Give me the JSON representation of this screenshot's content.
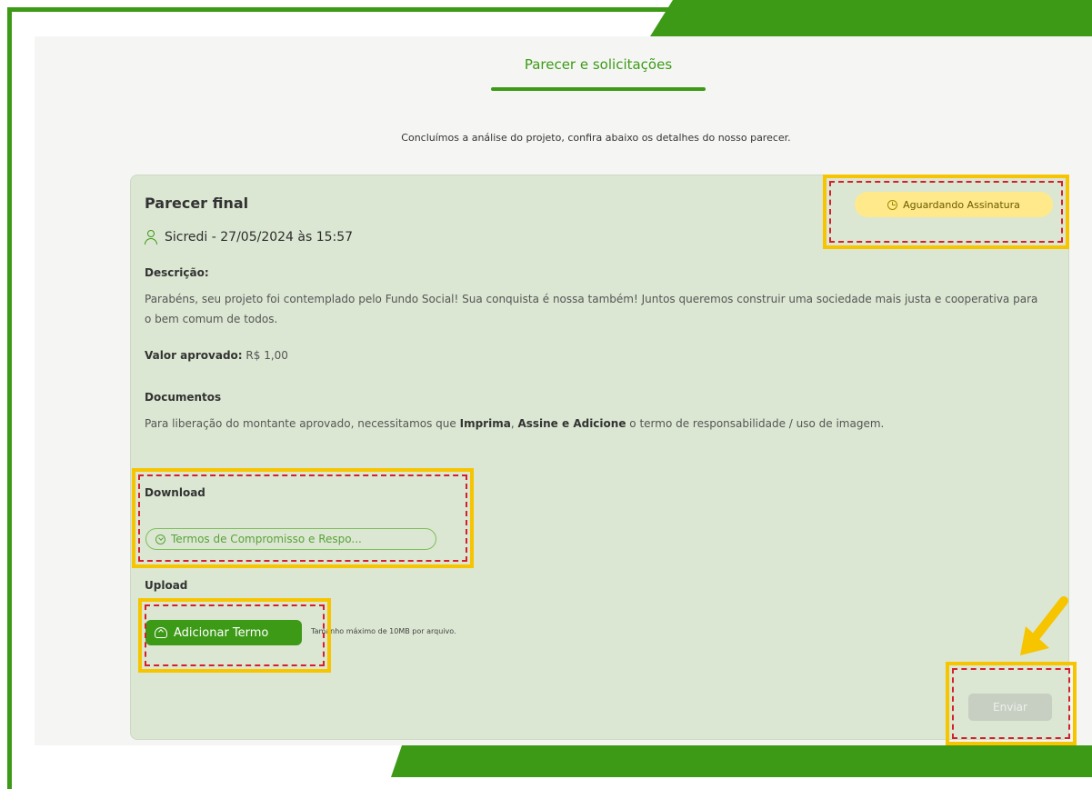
{
  "tab": {
    "title": "Parecer e solicitações"
  },
  "intro": "Concluímos a análise do projeto, confira abaixo os detalhes do nosso parecer.",
  "card": {
    "title": "Parecer final",
    "status_badge": "Aguardando Assinatura",
    "author": "Sicredi - 27/05/2024 às 15:57",
    "descricao_label": "Descrição:",
    "descricao_text": "Parabéns, seu projeto foi contemplado pelo Fundo Social! Sua conquista é nossa também! Juntos queremos construir uma sociedade mais justa e cooperativa para o bem comum de todos.",
    "valor_label": "Valor aprovado:",
    "valor_value": "R$ 1,00",
    "documentos_label": "Documentos",
    "documentos_text_1": "Para liberação do montante aprovado, necessitamos que ",
    "documentos_bold_1": "Imprima",
    "documentos_sep": ", ",
    "documentos_bold_2": "Assine e Adicione",
    "documentos_text_2": " o termo de responsabilidade / uso de imagem.",
    "download_label": "Download",
    "download_file": "Termos de Compromisso e Respo...",
    "upload_label": "Upload",
    "upload_button": "Adicionar Termo",
    "upload_hint": "Tamanho máximo de 10MB por arquivo.",
    "submit_button": "Enviar"
  },
  "colors": {
    "brand_green": "#3d9a17",
    "highlight_yellow": "#f7c400",
    "highlight_red": "#d4202a",
    "card_bg": "#dbe7d2"
  }
}
